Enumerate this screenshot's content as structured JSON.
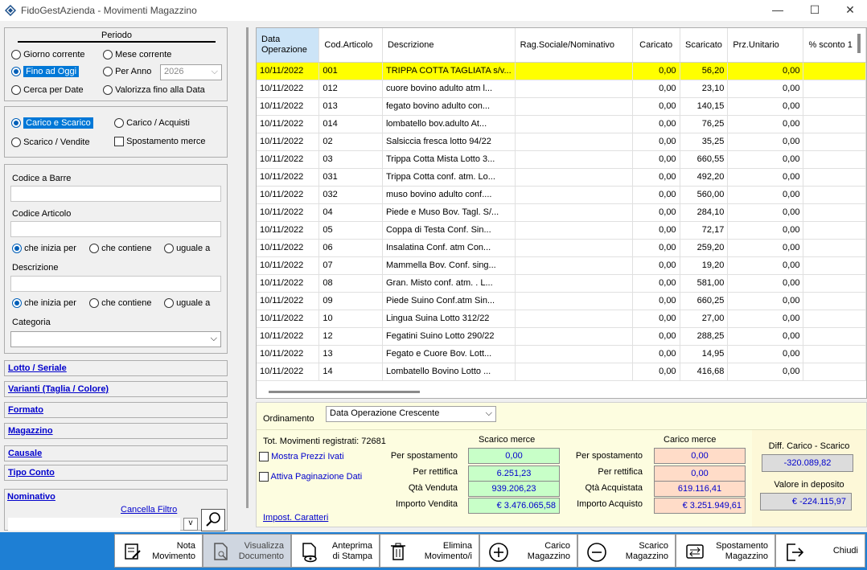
{
  "window": {
    "title": "FidoGestAzienda - Movimenti Magazzino",
    "minimize": "—",
    "maximize": "☐",
    "close": "✕"
  },
  "periodo": {
    "title": "Periodo",
    "giorno": "Giorno corrente",
    "mese": "Mese corrente",
    "fino": "Fino ad Oggi",
    "per_anno": "Per Anno",
    "anno": "2026",
    "cerca": "Cerca per Date",
    "valorizza": "Valorizza fino alla Data"
  },
  "tipo": {
    "carico_scarico": "Carico e Scarico",
    "carico": "Carico / Acquisti",
    "scarico": "Scarico / Vendite",
    "spostamento": "Spostamento merce"
  },
  "filtri": {
    "codice_barre": "Codice a Barre",
    "codice_articolo": "Codice Articolo",
    "inizia": "che inizia per",
    "contiene": "che contiene",
    "uguale": "uguale a",
    "descrizione": "Descrizione",
    "categoria": "Categoria"
  },
  "sections": [
    "Lotto / Seriale",
    "Varianti (Taglia / Colore)",
    "Formato",
    "Magazzino",
    "Causale",
    "Tipo Conto",
    "Nominativo"
  ],
  "nominativo": {
    "cancella": "Cancella Filtro",
    "dropdown": "v"
  },
  "grid": {
    "headers": [
      "Data Operazione",
      "Cod.Articolo",
      "Descrizione",
      "Rag.Sociale/Nominativo",
      "Caricato",
      "Scaricato",
      "Prz.Unitario",
      "% sconto 1"
    ],
    "rows": [
      [
        "10/11/2022",
        "001",
        "TRIPPA COTTA TAGLIATA s/v...",
        "",
        "0,00",
        "56,20",
        "0,00"
      ],
      [
        "10/11/2022",
        "012",
        "cuore bovino adulto atm l...",
        "",
        "0,00",
        "23,10",
        "0,00"
      ],
      [
        "10/11/2022",
        "013",
        "fegato bovino adulto con...",
        "",
        "0,00",
        "140,15",
        "0,00"
      ],
      [
        "10/11/2022",
        "014",
        "lombatello bov.adulto At...",
        "",
        "0,00",
        "76,25",
        "0,00"
      ],
      [
        "10/11/2022",
        "02",
        "Salsiccia fresca lotto 94/22",
        "",
        "0,00",
        "35,25",
        "0,00"
      ],
      [
        "10/11/2022",
        "03",
        "Trippa Cotta Mista Lotto 3...",
        "",
        "0,00",
        "660,55",
        "0,00"
      ],
      [
        "10/11/2022",
        "031",
        "Trippa Cotta conf. atm. Lo...",
        "",
        "0,00",
        "492,20",
        "0,00"
      ],
      [
        "10/11/2022",
        "032",
        "muso bovino adulto conf....",
        "",
        "0,00",
        "560,00",
        "0,00"
      ],
      [
        "10/11/2022",
        "04",
        "Piede e Muso Bov. Tagl. S/...",
        "",
        "0,00",
        "284,10",
        "0,00"
      ],
      [
        "10/11/2022",
        "05",
        "Coppa di Testa  Conf. Sin...",
        "",
        "0,00",
        "72,17",
        "0,00"
      ],
      [
        "10/11/2022",
        "06",
        "Insalatina Conf. atm  Con...",
        "",
        "0,00",
        "259,20",
        "0,00"
      ],
      [
        "10/11/2022",
        "07",
        "Mammella Bov. Conf. sing...",
        "",
        "0,00",
        "19,20",
        "0,00"
      ],
      [
        "10/11/2022",
        "08",
        "Gran. Misto conf. atm. . L...",
        "",
        "0,00",
        "581,00",
        "0,00"
      ],
      [
        "10/11/2022",
        "09",
        "Piede Suino  Conf.atm Sin...",
        "",
        "0,00",
        "660,25",
        "0,00"
      ],
      [
        "10/11/2022",
        "10",
        "Lingua Suina  Lotto 312/22",
        "",
        "0,00",
        "27,00",
        "0,00"
      ],
      [
        "10/11/2022",
        "12",
        "Fegatini Suino Lotto 290/22",
        "",
        "0,00",
        "288,25",
        "0,00"
      ],
      [
        "10/11/2022",
        "13",
        "Fegato e Cuore Bov. Lott...",
        "",
        "0,00",
        "14,95",
        "0,00"
      ],
      [
        "10/11/2022",
        "14",
        "Lombatello Bovino Lotto ...",
        "",
        "0,00",
        "416,68",
        "0,00"
      ]
    ]
  },
  "ordinamento": {
    "label": "Ordinamento",
    "value": "Data Operazione Crescente"
  },
  "totali": {
    "tot_label": "Tot. Movimenti registrati: 72681",
    "mostra": "Mostra Prezzi Ivati",
    "attiva": "Attiva Paginazione Dati",
    "impost": "Impost. Caratteri",
    "scarico_title": "Scarico merce",
    "carico_title": "Carico merce",
    "per_spostamento": "Per spostamento",
    "per_rettifica": "Per rettifica",
    "qta_venduta": "Qtà Venduta",
    "importo_vendita": "Importo Vendita",
    "qta_acquistata": "Qtà Acquistata",
    "importo_acquisto": "Importo Acquisto",
    "s_spost": "0,00",
    "s_rett": "6.251,23",
    "s_qta": "939.206,23",
    "s_imp": "€ 3.476.065,58",
    "c_spost": "0,00",
    "c_rett": "0,00",
    "c_qta": "619.116,41",
    "c_imp": "€ 3.251.949,61",
    "diff_label": "Diff. Carico - Scarico",
    "diff": "-320.089,82",
    "deposito_label": "Valore in deposito",
    "deposito": "€ -224.115,97"
  },
  "toolbar": [
    "Nota\nMovimento",
    "Visualizza\nDocumento",
    "Anteprima\ndi Stampa",
    "Elimina\nMovimento/i",
    "Carico\nMagazzino",
    "Scarico\nMagazzino",
    "Spostamento\nMagazzino",
    "Chiudi"
  ]
}
